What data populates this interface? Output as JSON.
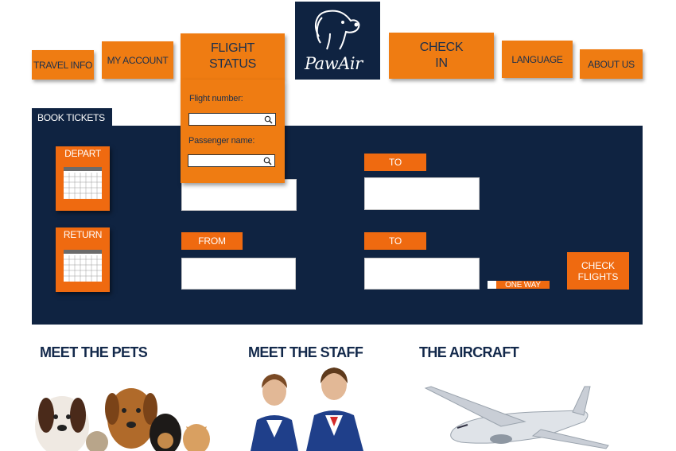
{
  "nav": {
    "travel_info": "TRAVEL INFO",
    "my_account": "MY ACCOUNT",
    "flight_status_1": "FLIGHT",
    "flight_status_2": "STATUS",
    "check_in_1": "CHECK",
    "check_in_2": "IN",
    "language": "LANGUAGE",
    "about_us": "ABOUT US"
  },
  "logo": {
    "text": "PawAir"
  },
  "flight_status_dropdown": {
    "flight_number_label": "Flight number:",
    "passenger_name_label": "Passenger name:"
  },
  "booking": {
    "tab": "BOOK TICKETS",
    "depart": "DEPART",
    "return": "RETURN",
    "from": "FROM",
    "to_top": "TO",
    "to_bottom": "TO",
    "one_way": "ONE WAY",
    "check_flights_1": "CHECK",
    "check_flights_2": "FLIGHTS"
  },
  "sections": {
    "pets": "MEET THE PETS",
    "staff": "MEET THE STAFF",
    "aircraft": "THE AIRCRAFT"
  },
  "colors": {
    "navy": "#0f2341",
    "orange": "#ef7c12",
    "orange_dark": "#ef6a10"
  },
  "icons": [
    "magnifier-icon",
    "calendar-icon",
    "dog-logo-icon"
  ]
}
